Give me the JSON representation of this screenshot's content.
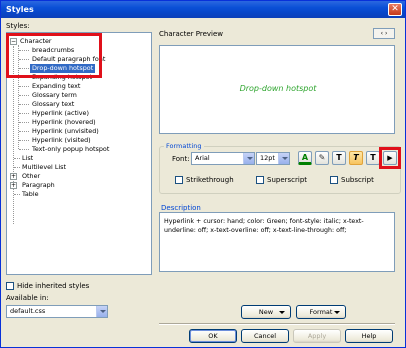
{
  "window": {
    "title": "Styles",
    "close": "✕"
  },
  "left": {
    "styles_label": "Styles:",
    "tree": {
      "character": "Character",
      "items": [
        "breadcrumbs",
        "Default paragraph font",
        "Drop-down hotspot",
        "Expanding hotspot",
        "Expanding text",
        "Glossary term",
        "Glossary text",
        "Hyperlink (active)",
        "Hyperlink (hovered)",
        "Hyperlink (unvisited)",
        "Hyperlink (visited)",
        "Text-only popup hotspot"
      ],
      "list": "List",
      "multilevel_list": "Multilevel List",
      "other": "Other",
      "paragraph": "Paragraph",
      "table": "Table",
      "selected_index": 2
    },
    "hide_inherited": "Hide inherited styles",
    "available_in_label": "Available in:",
    "available_in_value": "default.css"
  },
  "right": {
    "character_preview_label": "Character Preview",
    "preview_text": "Drop-down hotspot",
    "formatting": {
      "title": "Formatting",
      "font_label": "Font:",
      "font_value": "Arial",
      "size_value": "12pt",
      "strikethrough": "Strikethrough",
      "superscript": "Superscript",
      "subscript": "Subscript",
      "buttons": [
        "A",
        "✎",
        "T",
        "T",
        "T",
        "▶"
      ]
    },
    "description": {
      "title": "Description",
      "text": "Hyperlink + cursor: hand; color: Green; font-style: italic; x-text-underline: off; x-text-overline: off; x-text-line-through: off;"
    }
  },
  "buttons": {
    "new": "New",
    "format": "Format",
    "ok": "OK",
    "cancel": "Cancel",
    "apply": "Apply",
    "help": "Help"
  },
  "colors": {
    "preview_text": "#2ea52e",
    "selection": "#316ac5",
    "highlight_box": "#e0101a"
  }
}
